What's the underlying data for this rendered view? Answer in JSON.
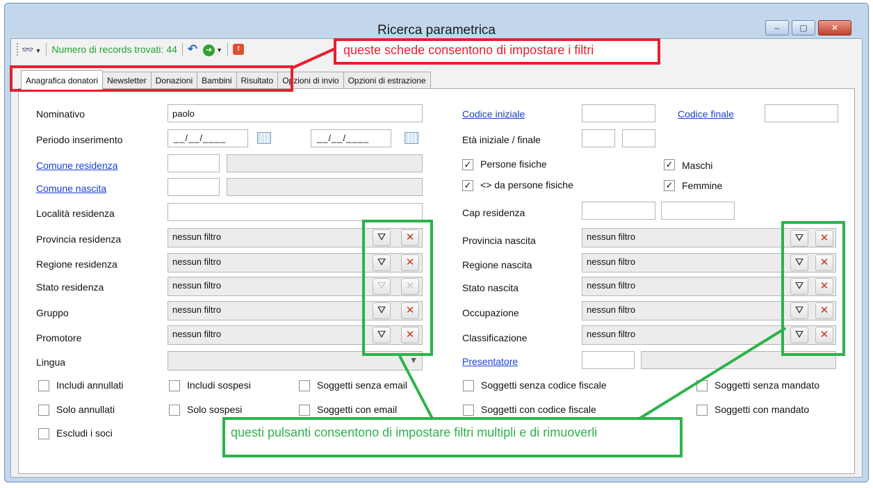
{
  "window": {
    "title": "Ricerca parametrica",
    "controls": [
      "minimize",
      "maximize",
      "close"
    ]
  },
  "toolbar": {
    "search_icon": "binoculars-icon",
    "records_label": "Numero di records trovati: 44",
    "undo_icon": "undo-icon",
    "go_icon": "go-arrow-icon",
    "stop_icon": "stop-icon"
  },
  "tabs": [
    {
      "label": "Anagrafica donatori",
      "active": true
    },
    {
      "label": "Newsletter"
    },
    {
      "label": "Donazioni"
    },
    {
      "label": "Bambini"
    },
    {
      "label": "Risultato"
    },
    {
      "label": "Opzioni di invio"
    },
    {
      "label": "Opzioni di estrazione"
    }
  ],
  "left": {
    "nominativo": {
      "label": "Nominativo",
      "value": "paolo"
    },
    "periodo": {
      "label": "Periodo inserimento",
      "from": "__/__/____",
      "to": "__/__/____"
    },
    "comune_residenza": {
      "label": "Comune residenza"
    },
    "comune_nascita": {
      "label": "Comune nascita"
    },
    "localita": {
      "label": "Località residenza"
    },
    "filters": [
      {
        "label": "Provincia residenza",
        "value": "nessun filtro"
      },
      {
        "label": "Regione residenza",
        "value": "nessun filtro"
      },
      {
        "label": "Stato residenza",
        "value": "nessun filtro"
      },
      {
        "label": "Gruppo",
        "value": "nessun filtro"
      },
      {
        "label": "Promotore",
        "value": "nessun filtro"
      }
    ],
    "lingua": {
      "label": "Lingua"
    }
  },
  "right": {
    "codice_iniziale": {
      "label": "Codice iniziale"
    },
    "codice_finale": {
      "label": "Codice finale"
    },
    "eta": {
      "label": "Età iniziale / finale"
    },
    "persone_fisiche": {
      "label": "Persone fisiche",
      "checked": true
    },
    "non_persone_fisiche": {
      "label": "<> da persone fisiche",
      "checked": true
    },
    "maschi": {
      "label": "Maschi",
      "checked": true
    },
    "femmine": {
      "label": "Femmine",
      "checked": true
    },
    "cap": {
      "label": "Cap residenza"
    },
    "filters": [
      {
        "label": "Provincia nascita",
        "value": "nessun filtro"
      },
      {
        "label": "Regione nascita",
        "value": "nessun filtro"
      },
      {
        "label": "Stato nascita",
        "value": "nessun filtro"
      },
      {
        "label": "Occupazione",
        "value": "nessun filtro"
      },
      {
        "label": "Classificazione",
        "value": "nessun filtro"
      }
    ],
    "presentatore": {
      "label": "Presentatore"
    }
  },
  "checks": {
    "includi_annullati": "Includi annullati",
    "solo_annullati": "Solo annullati",
    "escludi_soci": "Escludi i soci",
    "includi_sospesi": "Includi sospesi",
    "solo_sospesi": "Solo sospesi",
    "senza_email": "Soggetti senza email",
    "con_email": "Soggetti con email",
    "senza_cf": "Soggetti senza codice fiscale",
    "con_cf": "Soggetti con codice fiscale",
    "senza_mandato": "Soggetti senza mandato",
    "con_mandato": "Soggetti con mandato"
  },
  "annotations": {
    "red": "queste schede consentono di impostare i filtri",
    "green": "questi pulsanti consentono di impostare filtri multipli e di rimuoverli",
    "red_color": "#e5202f",
    "green_color": "#2cb34a"
  }
}
